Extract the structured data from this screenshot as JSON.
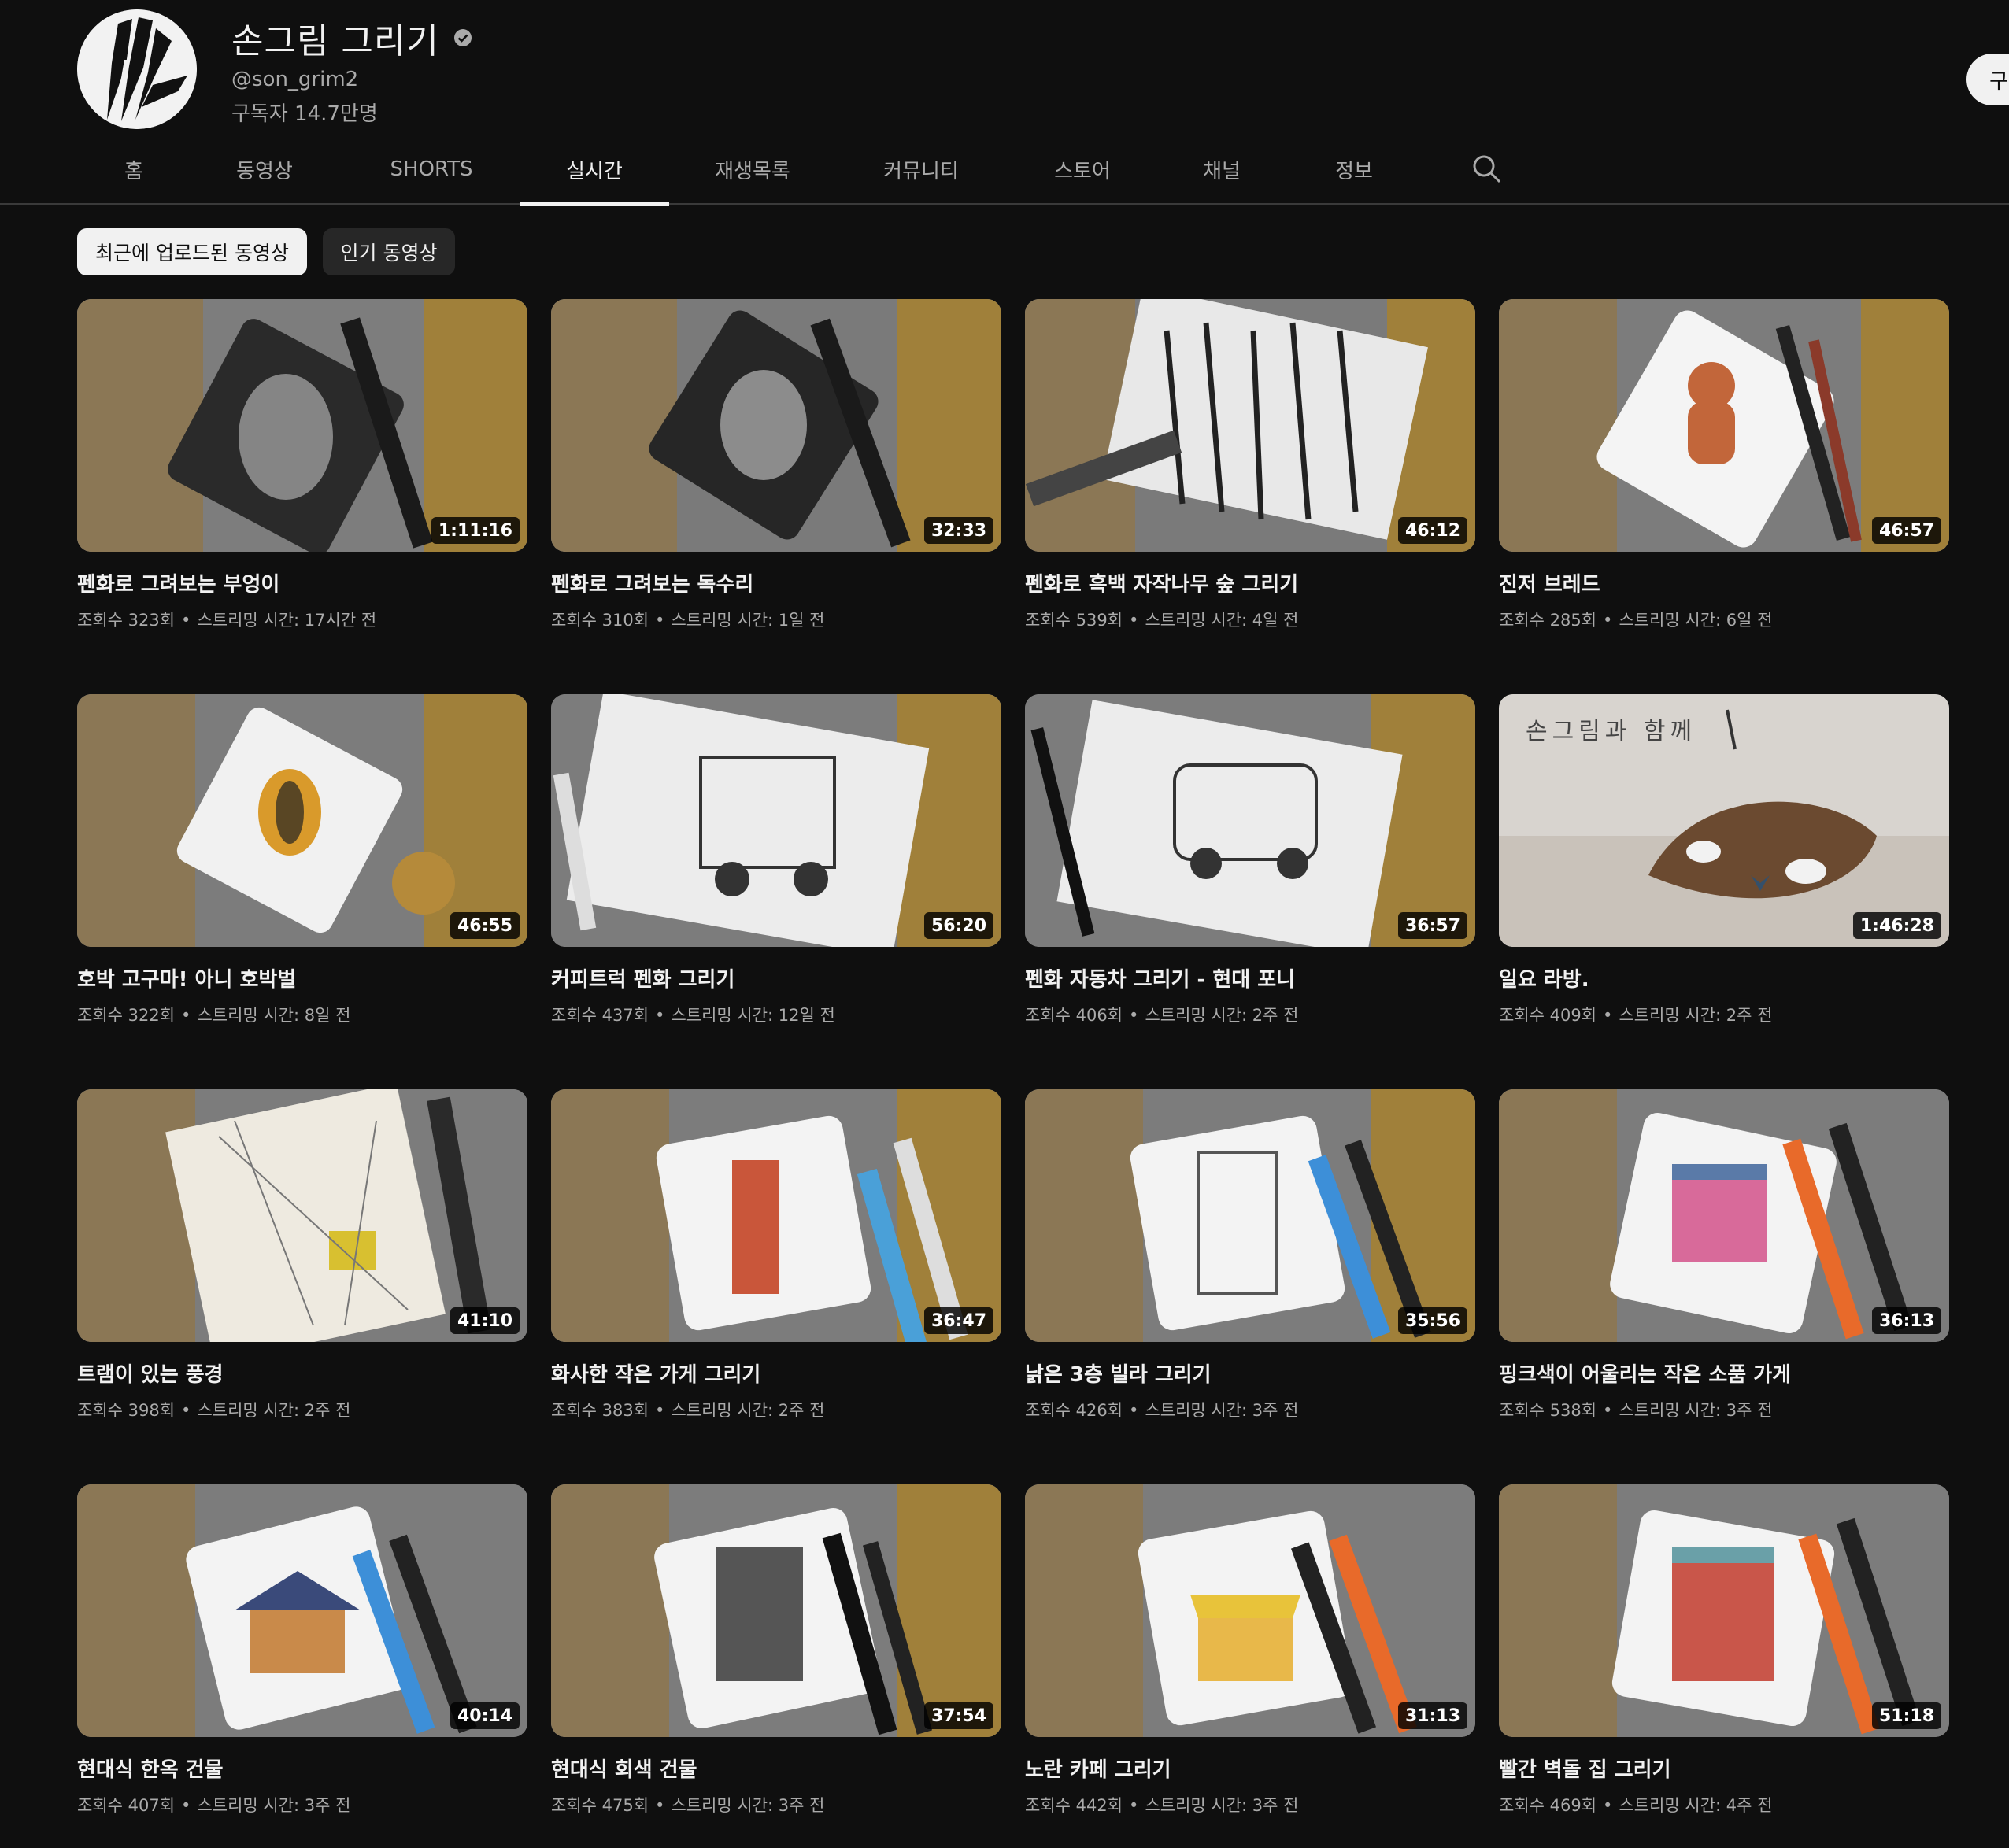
{
  "channel": {
    "name": "손그림 그리기",
    "handle": "@son_grim2",
    "subscribers": "구독자 14.7만명",
    "subscribe_label": "구독"
  },
  "tabs": [
    {
      "label": "홈"
    },
    {
      "label": "동영상"
    },
    {
      "label": "SHORTS"
    },
    {
      "label": "실시간",
      "active": true
    },
    {
      "label": "재생목록"
    },
    {
      "label": "커뮤니티"
    },
    {
      "label": "스토어"
    },
    {
      "label": "채널"
    },
    {
      "label": "정보"
    }
  ],
  "filters": [
    {
      "label": "최근에 업로드된 동영상",
      "selected": true
    },
    {
      "label": "인기 동영상",
      "selected": false
    }
  ],
  "meta_separator": "•",
  "colors": {
    "background": "#0f0f0f",
    "text_primary": "#f1f1f1",
    "text_secondary": "#aaaaaa",
    "chip_bg": "#272727"
  },
  "videos": [
    {
      "title": "펜화로 그려보는 부엉이",
      "duration": "1:11:16",
      "views": "조회수 323회",
      "streamed": "스트리밍 시간: 17시간 전"
    },
    {
      "title": "펜화로 그려보는 독수리",
      "duration": "32:33",
      "views": "조회수 310회",
      "streamed": "스트리밍 시간: 1일 전"
    },
    {
      "title": "펜화로 흑백 자작나무 숲 그리기",
      "duration": "46:12",
      "views": "조회수 539회",
      "streamed": "스트리밍 시간: 4일 전"
    },
    {
      "title": "진저 브레드",
      "duration": "46:57",
      "views": "조회수 285회",
      "streamed": "스트리밍 시간: 6일 전"
    },
    {
      "title": "호박 고구마! 아니 호박벌",
      "duration": "46:55",
      "views": "조회수 322회",
      "streamed": "스트리밍 시간: 8일 전"
    },
    {
      "title": "커피트럭 펜화 그리기",
      "duration": "56:20",
      "views": "조회수 437회",
      "streamed": "스트리밍 시간: 12일 전"
    },
    {
      "title": "펜화 자동차 그리기 - 현대 포니",
      "duration": "36:57",
      "views": "조회수 406회",
      "streamed": "스트리밍 시간: 2주 전"
    },
    {
      "title": "일요 라방.",
      "duration": "1:46:28",
      "views": "조회수 409회",
      "streamed": "스트리밍 시간: 2주 전",
      "caption": "손그림과 함께"
    },
    {
      "title": "트램이 있는 풍경",
      "duration": "41:10",
      "views": "조회수 398회",
      "streamed": "스트리밍 시간: 2주 전"
    },
    {
      "title": "화사한 작은 가게 그리기",
      "duration": "36:47",
      "views": "조회수 383회",
      "streamed": "스트리밍 시간: 2주 전"
    },
    {
      "title": "낡은 3층 빌라 그리기",
      "duration": "35:56",
      "views": "조회수 426회",
      "streamed": "스트리밍 시간: 3주 전"
    },
    {
      "title": "핑크색이 어울리는 작은 소품 가게",
      "duration": "36:13",
      "views": "조회수 538회",
      "streamed": "스트리밍 시간: 3주 전"
    },
    {
      "title": "현대식 한옥 건물",
      "duration": "40:14",
      "views": "조회수 407회",
      "streamed": "스트리밍 시간: 3주 전"
    },
    {
      "title": "현대식 회색 건물",
      "duration": "37:54",
      "views": "조회수 475회",
      "streamed": "스트리밍 시간: 3주 전"
    },
    {
      "title": "노란 카페 그리기",
      "duration": "31:13",
      "views": "조회수 442회",
      "streamed": "스트리밍 시간: 3주 전"
    },
    {
      "title": "빨간 벽돌 집 그리기",
      "duration": "51:18",
      "views": "조회수 469회",
      "streamed": "스트리밍 시간: 4주 전"
    }
  ]
}
